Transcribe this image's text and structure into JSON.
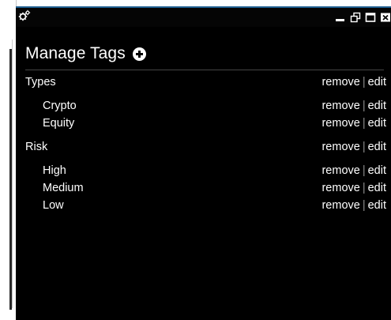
{
  "window": {
    "title_icon": "gears-icon",
    "controls": [
      "minimize-icon",
      "restore-icon",
      "maximize-icon",
      "close-icon"
    ]
  },
  "heading": "Manage Tags",
  "add_icon": "plus-circle-icon",
  "actions": {
    "remove": "remove",
    "separator": "|",
    "edit": "edit"
  },
  "groups": [
    {
      "name": "Types",
      "children": [
        "Crypto",
        "Equity"
      ]
    },
    {
      "name": "Risk",
      "children": [
        "High",
        "Medium",
        "Low"
      ]
    }
  ],
  "colors": {
    "window_bg": "#000000",
    "text": "#ffffff",
    "separator": "#8a8a8a",
    "accent": "#1f5f90"
  }
}
